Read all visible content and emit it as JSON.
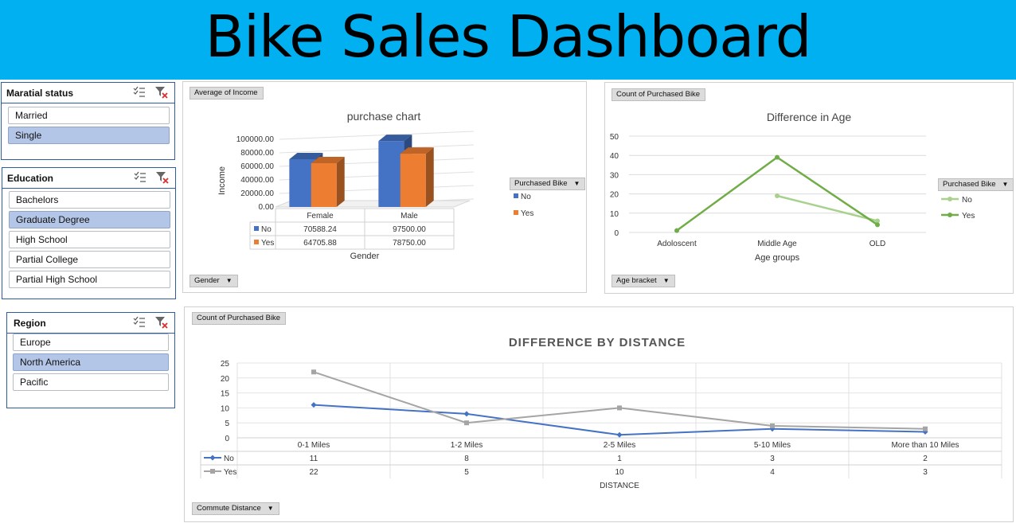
{
  "header": {
    "title": "Bike Sales Dashboard"
  },
  "slicers": {
    "marital": {
      "title": "Maratial status",
      "items": [
        {
          "label": "Married",
          "selected": false
        },
        {
          "label": "Single",
          "selected": true
        }
      ]
    },
    "education": {
      "title": "Education",
      "items": [
        {
          "label": "Bachelors",
          "selected": false
        },
        {
          "label": "Graduate Degree",
          "selected": true
        },
        {
          "label": "High School",
          "selected": false
        },
        {
          "label": "Partial College",
          "selected": false
        },
        {
          "label": "Partial High School",
          "selected": false
        }
      ]
    },
    "region": {
      "title": "Region",
      "items": [
        {
          "label": "Europe",
          "selected": false
        },
        {
          "label": "North America",
          "selected": true
        },
        {
          "label": "Pacific",
          "selected": false
        }
      ]
    }
  },
  "charts": {
    "income": {
      "value_button": "Average of Income",
      "axis_button": "Gender",
      "legend_button": "Purchased Bike"
    },
    "age": {
      "value_button": "Count of Purchased Bike",
      "axis_button": "Age bracket",
      "legend_button": "Purchased Bike"
    },
    "distance": {
      "value_button": "Count of Purchased Bike",
      "axis_button": "Commute Distance"
    }
  },
  "colors": {
    "banner": "#00B0F0",
    "no_bar": "#4472C4",
    "yes_bar": "#ED7D31",
    "age_no": "#A9D18E",
    "age_yes": "#70AD47",
    "dist_no": "#4472C4",
    "dist_yes": "#A5A5A5",
    "selected_item": "#B4C6E7"
  },
  "chart_data": [
    {
      "type": "bar",
      "title": "purchase chart",
      "xlabel": "Gender",
      "ylabel": "Income",
      "categories": [
        "Female",
        "Male"
      ],
      "series": [
        {
          "name": "No",
          "values": [
            70588.24,
            97500.0
          ],
          "labels": [
            "70588.24",
            "97500.00"
          ]
        },
        {
          "name": "Yes",
          "values": [
            64705.88,
            78750.0
          ],
          "labels": [
            "64705.88",
            "78750.00"
          ]
        }
      ],
      "ylim": [
        0,
        100000
      ],
      "yticks": [
        0,
        20000,
        40000,
        60000,
        80000,
        100000
      ],
      "ytick_labels": [
        "0.00",
        "20000.00",
        "40000.00",
        "60000.00",
        "80000.00",
        "100000.00"
      ],
      "legend_position": "right",
      "data_table": true
    },
    {
      "type": "line",
      "title": "Difference in Age",
      "xlabel": "Age groups",
      "ylabel": "",
      "categories": [
        "Adoloscent",
        "Middle Age",
        "OLD"
      ],
      "series": [
        {
          "name": "No",
          "values": [
            null,
            19,
            6
          ]
        },
        {
          "name": "Yes",
          "values": [
            1,
            39,
            4
          ]
        }
      ],
      "ylim": [
        0,
        50
      ],
      "yticks": [
        0,
        10,
        20,
        30,
        40,
        50
      ],
      "legend_position": "right",
      "grid": true
    },
    {
      "type": "line",
      "title": "DIFFERENCE BY DISTANCE",
      "xlabel": "DISTANCE",
      "ylabel": "",
      "categories": [
        "0-1 Miles",
        "1-2 Miles",
        "2-5 Miles",
        "5-10 Miles",
        "More than 10 Miles"
      ],
      "series": [
        {
          "name": "No",
          "values": [
            11,
            8,
            1,
            3,
            2
          ]
        },
        {
          "name": "Yes",
          "values": [
            22,
            5,
            10,
            4,
            3
          ]
        }
      ],
      "ylim": [
        0,
        25
      ],
      "yticks": [
        0,
        5,
        10,
        15,
        20,
        25
      ],
      "grid": true,
      "data_table": true
    }
  ]
}
